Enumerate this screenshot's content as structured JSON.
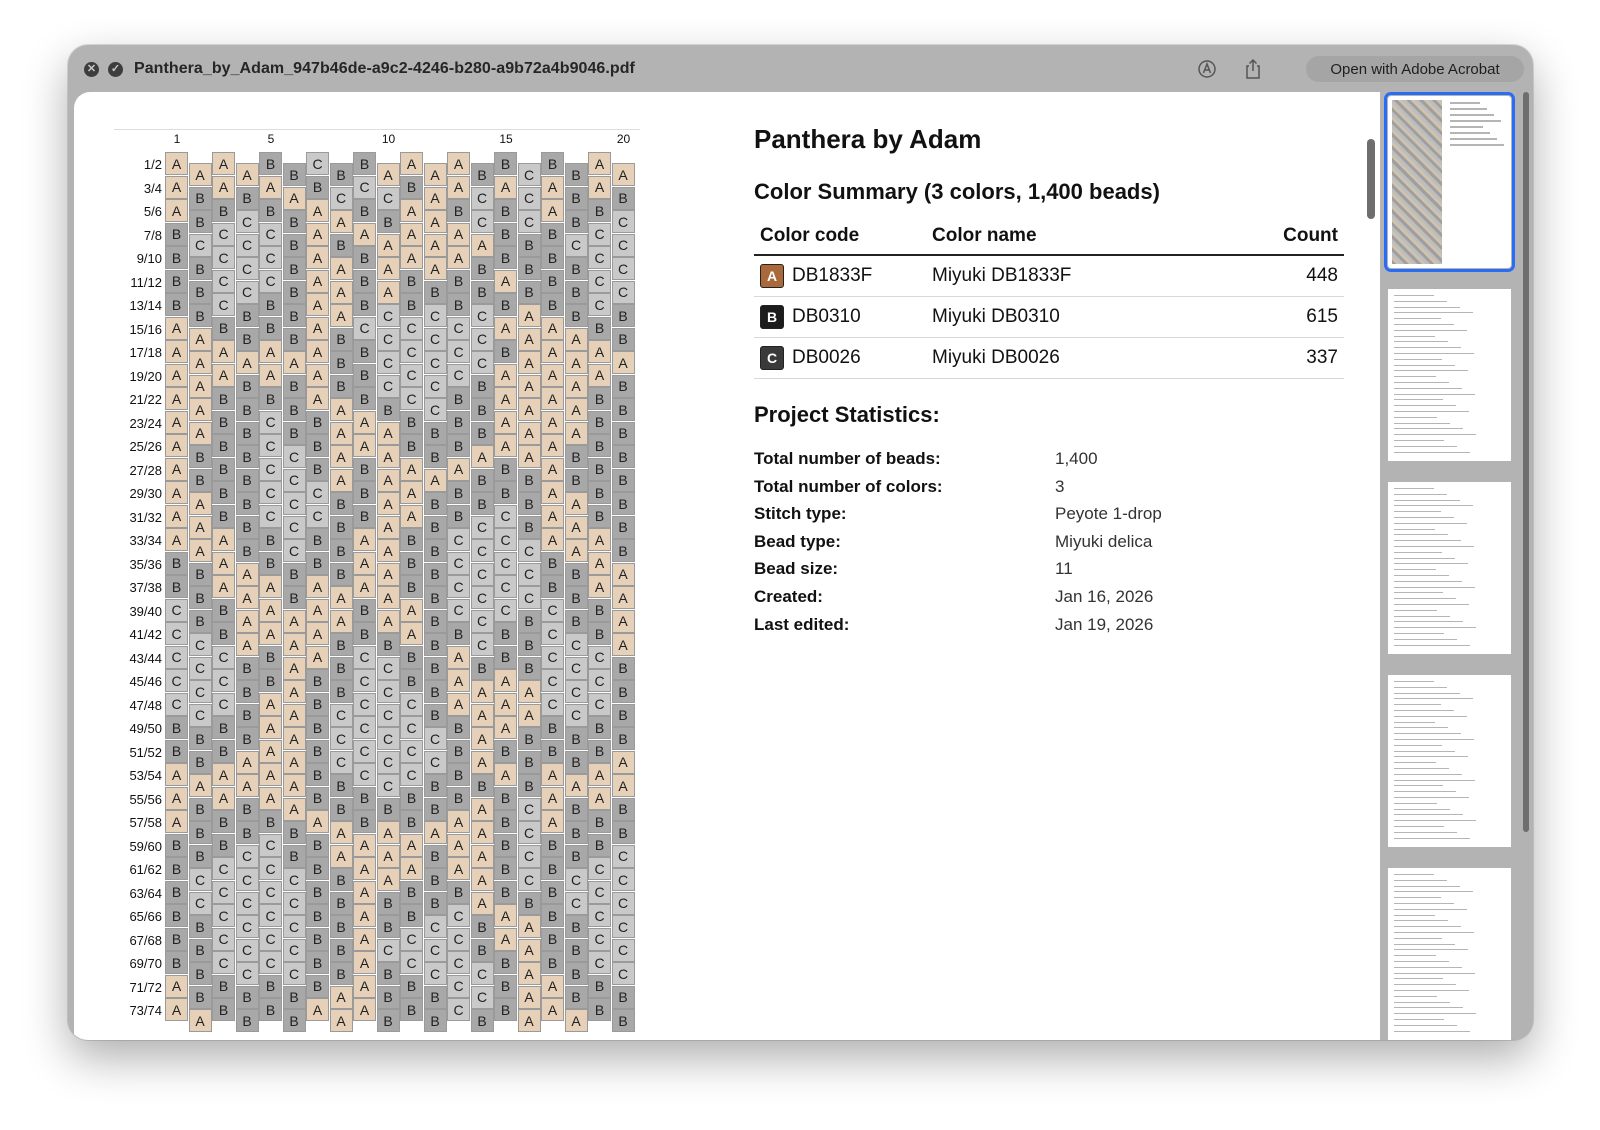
{
  "window": {
    "title": "Panthera_by_Adam_947b46de-a9c2-4246-b280-a9b72a4b9046.pdf",
    "open_button": "Open with Adobe Acrobat",
    "close_icon": "close-icon",
    "info_icon": "info-icon",
    "markup_icon": "markup-icon",
    "share_icon": "share-icon"
  },
  "pattern": {
    "column_numbers": [
      "1",
      "5",
      "10",
      "15",
      "20"
    ],
    "rows": [
      {
        "label": "1/2",
        "beads": "AA-AA-B-B-C----B-B-"
      },
      {
        "label": "3/4",
        "beads": "ABABAABCCCBAACAC"
      },
      {
        "label": "5/6",
        "beads": "ABBCBBAABBAABCBC"
      },
      {
        "label": "7/8",
        "beads": "BCCCCBABAAAAAABB"
      },
      {
        "label": "9/10",
        "beads": "BBCCCBAABAAAABBB"
      },
      {
        "label": "11/12",
        "beads": "BBCCCBAABABBBBAB"
      },
      {
        "label": "13/14",
        "beads": "BBCBBBAABCBCBCBA"
      },
      {
        "label": "15/16",
        "beads": "AABBBBABCCCCCCAA"
      },
      {
        "label": "17/18",
        "beads": "AAAAAAABBCCCCCBA"
      },
      {
        "label": "19/20",
        "beads": "AAABABABBCCCCBAA"
      },
      {
        "label": "21/22",
        "beads": "AABBBBAABBCCBBAA"
      },
      {
        "label": "23/24",
        "beads": "AABBCBBAAABBBBAA"
      },
      {
        "label": "25/26",
        "beads": "ABBBCCBAAABBBAAA"
      },
      {
        "label": "27/28",
        "beads": "ABBBCCBABAAAABBB"
      },
      {
        "label": "29/30",
        "beads": "AABBCCCBBAABBBBB"
      },
      {
        "label": "31/32",
        "beads": "AABBCCCBBAABBCCB"
      },
      {
        "label": "33/34",
        "beads": "AAABBCBBAABBCCCC"
      },
      {
        "label": "35/36",
        "beads": "BBAABBBBAABBCCCC"
      },
      {
        "label": "37/38",
        "beads": "BBAAABAAAABBCCCC"
      },
      {
        "label": "39/40",
        "beads": "CBBAAAAABAABCCCB"
      },
      {
        "label": "41/42",
        "beads": "CCBAAAABBBABBCBB"
      },
      {
        "label": "43/44",
        "beads": "CCCBBAABCCBBABBB"
      },
      {
        "label": "45/46",
        "beads": "CCCBBABBCCBBAAAA"
      },
      {
        "label": "47/48",
        "beads": "CCCBAABCCCCBAAAA"
      },
      {
        "label": "49/50",
        "beads": "BBBBAABCCCCCBAAB"
      },
      {
        "label": "51/52",
        "beads": "BBBAAABCCCCCBABB"
      },
      {
        "label": "53/54",
        "beads": "AAAAAABBCCCBBBAB"
      },
      {
        "label": "55/56",
        "beads": "ABABAABBBBBBBABC"
      },
      {
        "label": "57/58",
        "beads": "ABBBBBAABABAAABC"
      },
      {
        "label": "59/60",
        "beads": "BBBCCBBAAAABAABC"
      },
      {
        "label": "61/62",
        "beads": "BCCCCCBBAAABAABC"
      },
      {
        "label": "63/64",
        "beads": "BCCCCCBBABBBBABB"
      },
      {
        "label": "65/66",
        "beads": "BBCCCCBBABBCCBAA"
      },
      {
        "label": "67/68",
        "beads": "BBCCCCBBACCCCBAA"
      },
      {
        "label": "69/70",
        "beads": "BBCCCCBBABCCCCBA"
      },
      {
        "label": "71/72",
        "beads": "ABBBBBBAABBBCCBA"
      },
      {
        "label": "73/74",
        "beads": "AABBBBAAABBBCBBA"
      }
    ]
  },
  "doc": {
    "title": "Panthera by Adam",
    "summary_title": "Color Summary (3 colors, 1,400 beads)",
    "table_headers": {
      "code": "Color code",
      "name": "Color name",
      "count": "Count"
    },
    "colors": [
      {
        "letter": "A",
        "code": "DB1833F",
        "name": "Miyuki DB1833F",
        "count": "448",
        "swatch": "#a9693a"
      },
      {
        "letter": "B",
        "code": "DB0310",
        "name": "Miyuki DB0310",
        "count": "615",
        "swatch": "#1c1c1c"
      },
      {
        "letter": "C",
        "code": "DB0026",
        "name": "Miyuki DB0026",
        "count": "337",
        "swatch": "#3a3a3a"
      }
    ],
    "stats_title": "Project Statistics:",
    "stats": [
      {
        "label": "Total number of beads:",
        "value": "1,400"
      },
      {
        "label": "Total number of colors:",
        "value": "3"
      },
      {
        "label": "Stitch type:",
        "value": "Peyote 1-drop"
      },
      {
        "label": "Bead type:",
        "value": "Miyuki delica"
      },
      {
        "label": "Bead size:",
        "value": "11"
      },
      {
        "label": "Created:",
        "value": "Jan 16, 2026"
      },
      {
        "label": "Last edited:",
        "value": "Jan 19, 2026"
      }
    ]
  },
  "sidebar": {
    "pages": 5,
    "selected_page": 1
  },
  "colors": {
    "bead_A": "#e6d1b8",
    "bead_B": "#a8a8a8",
    "bead_C": "#c9c9c9",
    "selection": "#2a6df4"
  }
}
